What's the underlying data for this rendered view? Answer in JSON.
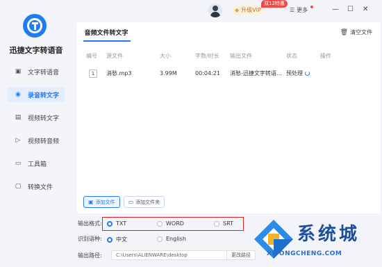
{
  "app": {
    "name": "迅捷文字转语音"
  },
  "sidebar": {
    "items": [
      {
        "label": "文字转语音",
        "icon": "speech-icon"
      },
      {
        "label": "录音转文字",
        "icon": "record-icon",
        "active": true
      },
      {
        "label": "视频转文字",
        "icon": "video-text-icon"
      },
      {
        "label": "视频转音频",
        "icon": "video-audio-icon"
      },
      {
        "label": "工具箱",
        "icon": "toolbox-icon"
      },
      {
        "label": "转换文件",
        "icon": "file-convert-icon"
      }
    ]
  },
  "titlebar": {
    "vip_label": "升级VIP",
    "promo_badge": "双12特惠",
    "more_label": "更多"
  },
  "panel": {
    "tab_label": "音频文件转文字",
    "clear_label": "清空文件",
    "columns": [
      "编号",
      "源文件",
      "大小",
      "字数/时长",
      "输出文件",
      "状态",
      "操作"
    ],
    "rows": [
      {
        "index": "1",
        "source": "消愁.mp3",
        "size": "3.99M",
        "duration": "00:04:21",
        "output": "消愁-迅捷文字转语…",
        "status": "预处理"
      }
    ],
    "add_file_label": "添加文件",
    "add_folder_label": "添加文件夹"
  },
  "settings": {
    "format_label": "输出格式:",
    "formats": [
      {
        "label": "TXT",
        "selected": true
      },
      {
        "label": "WORD",
        "selected": false
      },
      {
        "label": "SRT",
        "selected": false
      }
    ],
    "language_label": "识别语种:",
    "languages": [
      {
        "label": "中文",
        "selected": true
      },
      {
        "label": "English",
        "selected": false
      }
    ],
    "path_label": "输出路径:",
    "path_value": "C:\\Users\\ALIENWARE\\desktop",
    "change_path_label": "更改路径"
  },
  "watermark": {
    "text": "系统城",
    "url": "XITONGCHENG.COM"
  },
  "colors": {
    "accent": "#1f7cf4",
    "highlight_box": "#e02020",
    "vip": "#b57a2a"
  }
}
